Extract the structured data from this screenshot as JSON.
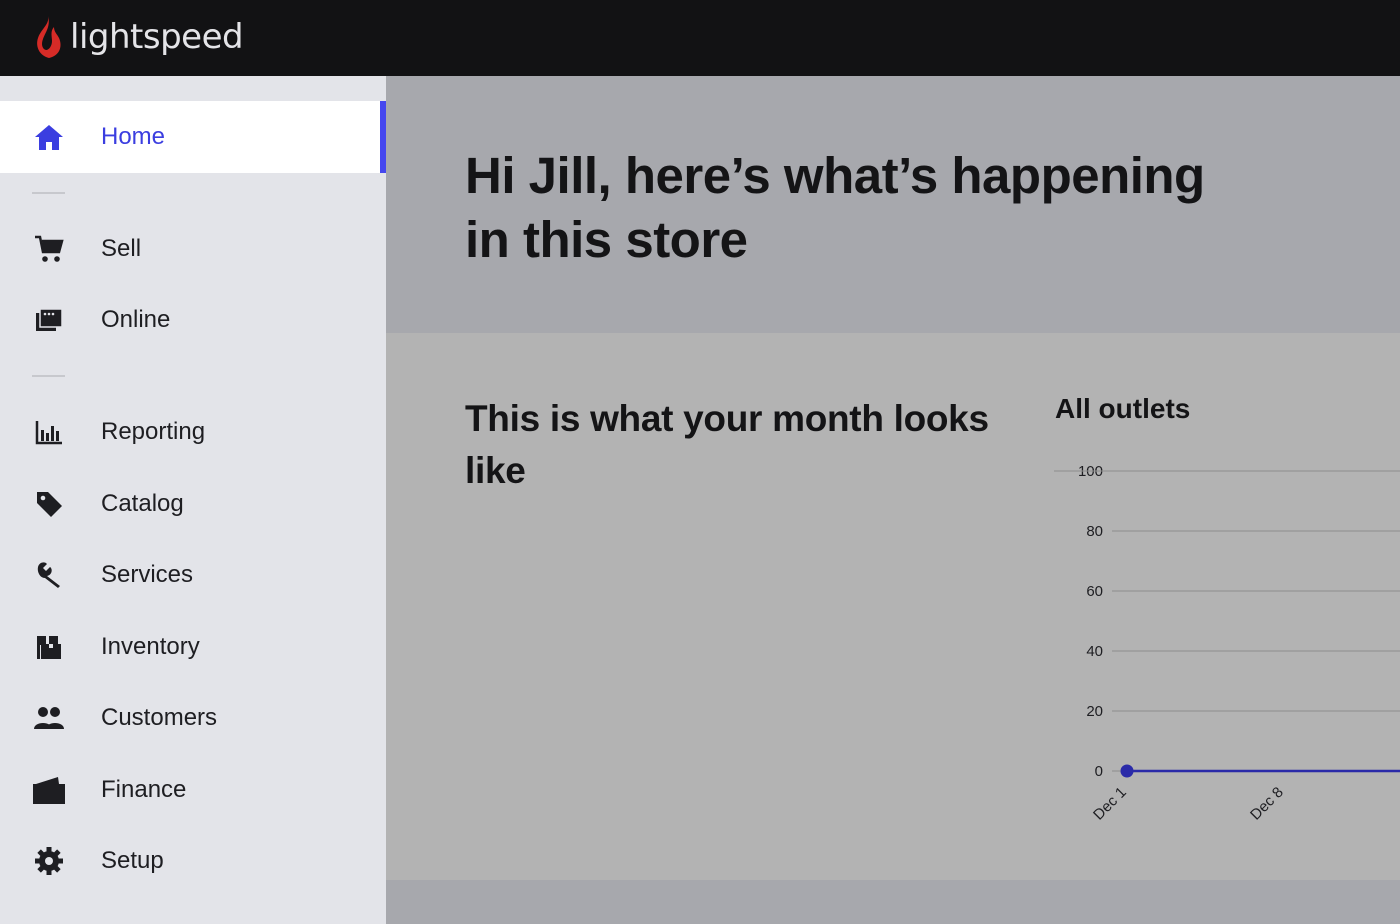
{
  "header": {
    "logo_text": "lightspeed",
    "brand_color": "#d62b27"
  },
  "sidebar": {
    "accent_color": "#4547ee",
    "items": [
      {
        "label": "Home",
        "icon": "home-icon",
        "active": true
      },
      {
        "label": "Sell",
        "icon": "cart-icon",
        "active": false
      },
      {
        "label": "Online",
        "icon": "online-store-icon",
        "active": false
      },
      {
        "label": "Reporting",
        "icon": "bar-chart-icon",
        "active": false
      },
      {
        "label": "Catalog",
        "icon": "tag-icon",
        "active": false
      },
      {
        "label": "Services",
        "icon": "wrench-icon",
        "active": false
      },
      {
        "label": "Inventory",
        "icon": "boxes-icon",
        "active": false
      },
      {
        "label": "Customers",
        "icon": "people-icon",
        "active": false
      },
      {
        "label": "Finance",
        "icon": "wallet-icon",
        "active": false
      },
      {
        "label": "Setup",
        "icon": "gear-icon",
        "active": false
      }
    ]
  },
  "hero": {
    "greeting": "Hi Jill, here’s what’s happening in this store"
  },
  "month": {
    "title": "This is what your month looks like"
  },
  "chart_data": {
    "type": "line",
    "title": "All outlets",
    "xlabel": "",
    "ylabel": "",
    "ylim": [
      0,
      100
    ],
    "yticks": [
      0,
      20,
      40,
      60,
      80,
      100
    ],
    "categories": [
      "Dec 1",
      "Dec 8"
    ],
    "grid": true,
    "line_color": "#2a2aa8",
    "series": [
      {
        "values": [
          0,
          0
        ]
      }
    ]
  }
}
